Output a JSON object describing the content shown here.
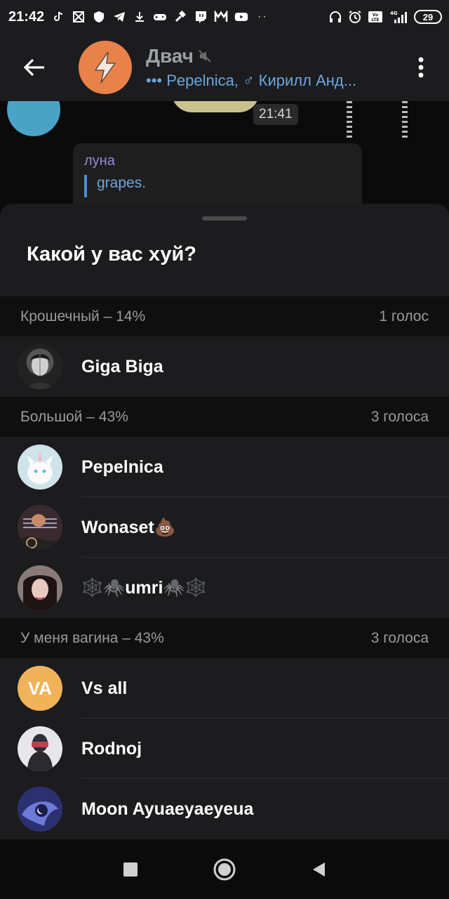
{
  "status_bar": {
    "time": "21:42",
    "network": "4G",
    "volte": "Vo LTE",
    "battery": "29",
    "left_icons": [
      "tiktok-icon",
      "crossed-box-icon",
      "shield-icon",
      "telegram-icon",
      "download-icon",
      "gamepad-icon",
      "hammer-icon",
      "twitch-icon",
      "m-logo-icon",
      "youtube-icon"
    ],
    "right_icons": [
      "headphones-icon",
      "alarm-icon",
      "volte-icon",
      "signal-icon",
      "battery-icon"
    ]
  },
  "header": {
    "title": "Двач",
    "subtitle": "••• Pepelnica, ♂ Кирилл Анд...",
    "avatar_color": "#e8824a",
    "muted": true
  },
  "chat": {
    "message_time": "21:41",
    "reply_name": "луна",
    "reply_text": "grapes."
  },
  "poll": {
    "question": "Какой у вас хуй?",
    "options": [
      {
        "title": "Крошечный – 14%",
        "votes": "1 голос",
        "voters": [
          {
            "name": "Giga Biga",
            "avatar": "portrait-photo"
          }
        ]
      },
      {
        "title": "Большой – 43%",
        "votes": "3 голоса",
        "voters": [
          {
            "name": "Pepelnica",
            "avatar": "white-cat-unicorn-photo"
          },
          {
            "name": "Wonaset",
            "emoji": "💩",
            "avatar": "anime-photo"
          },
          {
            "name": "umri",
            "prefix": "🕸️🕷️",
            "suffix": "🕷️🕸️",
            "avatar": "girl-photo"
          }
        ]
      },
      {
        "title": "У меня вагина – 43%",
        "votes": "3 голоса",
        "voters": [
          {
            "name": "Vs all",
            "initials": "VA",
            "avatar_color": "#f0b35a"
          },
          {
            "name": "Rodnoj",
            "avatar": "hooded-person-photo"
          },
          {
            "name": "Moon Ayuaeyaeyeua",
            "avatar": "moon-art-photo"
          }
        ]
      }
    ]
  },
  "navigation": [
    "recents-button",
    "home-button",
    "back-button"
  ]
}
